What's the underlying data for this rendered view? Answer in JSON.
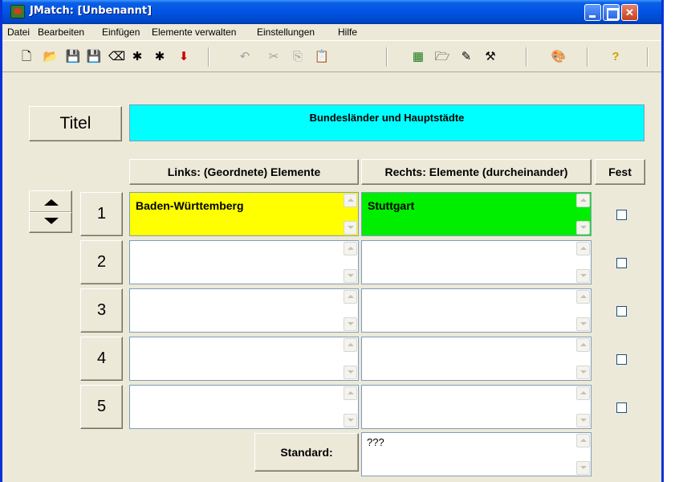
{
  "window": {
    "title": "JMatch: [Unbenannt]"
  },
  "menu": [
    "Datei",
    "Bearbeiten",
    "Einfügen",
    "Elemente verwalten",
    "Einstellungen",
    "Hilfe"
  ],
  "toolbar_icons": [
    "new-file-icon",
    "open-folder-icon",
    "save-icon",
    "save-as-icon",
    "clear-icon",
    "export-web-icon",
    "export-web2-icon",
    "add-icon",
    "undo-icon",
    "cut-icon",
    "copy-icon",
    "paste-icon",
    "config-icon",
    "config-load-icon",
    "config-edit-icon",
    "config-save-icon",
    "colors-icon",
    "help-icon"
  ],
  "title": {
    "label": "Titel",
    "value": "Bundesländer und Hauptstädte"
  },
  "columns": {
    "left": "Links: (Geordnete) Elemente",
    "right": "Rechts: Elemente (durcheinander)",
    "fest": "Fest"
  },
  "rows": [
    {
      "num": "1",
      "left": "Baden-Württemberg",
      "right": "Stuttgart",
      "left_color": "#ffff00",
      "right_color": "#00ee00"
    },
    {
      "num": "2",
      "left": "",
      "right": ""
    },
    {
      "num": "3",
      "left": "",
      "right": ""
    },
    {
      "num": "4",
      "left": "",
      "right": ""
    },
    {
      "num": "5",
      "left": "",
      "right": ""
    }
  ],
  "standard": {
    "label": "Standard:",
    "value": "???"
  },
  "colors": {
    "title_bg": "#00ffff",
    "titlebar": "#0054e3",
    "window_bg": "#ece9d8"
  }
}
